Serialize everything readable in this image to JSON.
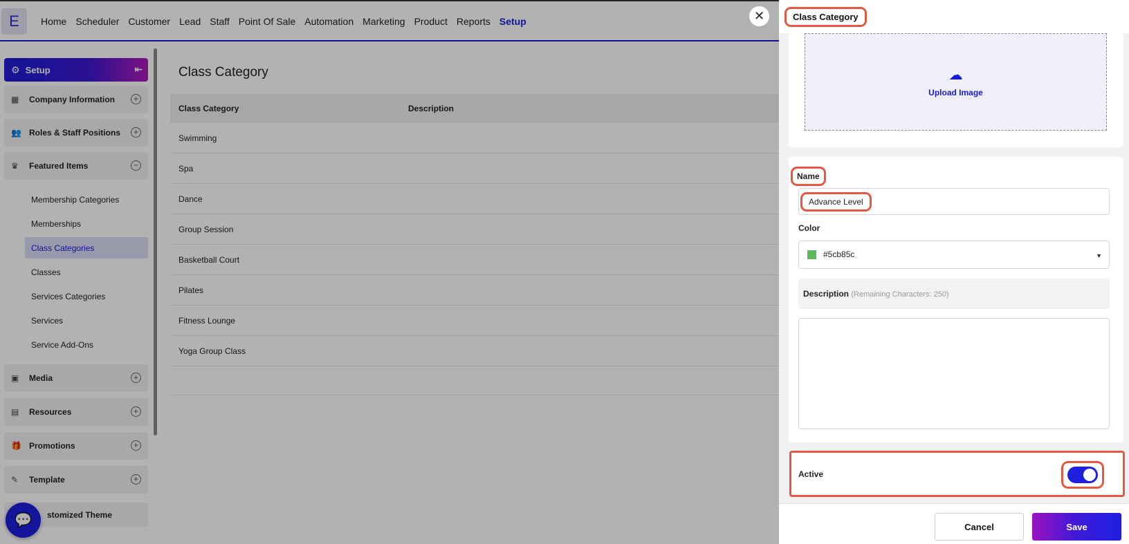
{
  "app": {
    "logo_letter": "E"
  },
  "nav": [
    "Home",
    "Scheduler",
    "Customer",
    "Lead",
    "Staff",
    "Point Of Sale",
    "Automation",
    "Marketing",
    "Product",
    "Reports",
    "Setup"
  ],
  "nav_active": "Setup",
  "sidebar": {
    "header": "Setup",
    "groups": {
      "company": "Company Information",
      "roles": "Roles & Staff Positions",
      "featured": "Featured Items",
      "media": "Media",
      "resources": "Resources",
      "promotions": "Promotions",
      "template": "Template",
      "customized": "stomized Theme"
    },
    "featured_items": [
      "Membership Categories",
      "Memberships",
      "Class Categories",
      "Classes",
      "Services Categories",
      "Services",
      "Service Add-Ons"
    ],
    "active_item": "Class Categories"
  },
  "main": {
    "title": "Class Category",
    "columns": [
      "Class Category",
      "Description"
    ],
    "rows": [
      "Swimming",
      "Spa",
      "Dance",
      "Group Session",
      "Basketball Court",
      "Pilates",
      "Fitness Lounge",
      "Yoga Group Class"
    ]
  },
  "panel": {
    "title": "Class Category",
    "upload_label": "Upload Image",
    "name_label": "Name",
    "name_value": "Advance Level",
    "color_label": "Color",
    "color_value": "#5cb85c",
    "description_label": "Description",
    "description_hint": "(Remaining Characters: 250)",
    "active_label": "Active",
    "active_on": true,
    "cancel_label": "Cancel",
    "save_label": "Save"
  },
  "colors": {
    "accent": "#1a1ad6",
    "highlight": "#e05a43",
    "swatch": "#5cb85c"
  }
}
